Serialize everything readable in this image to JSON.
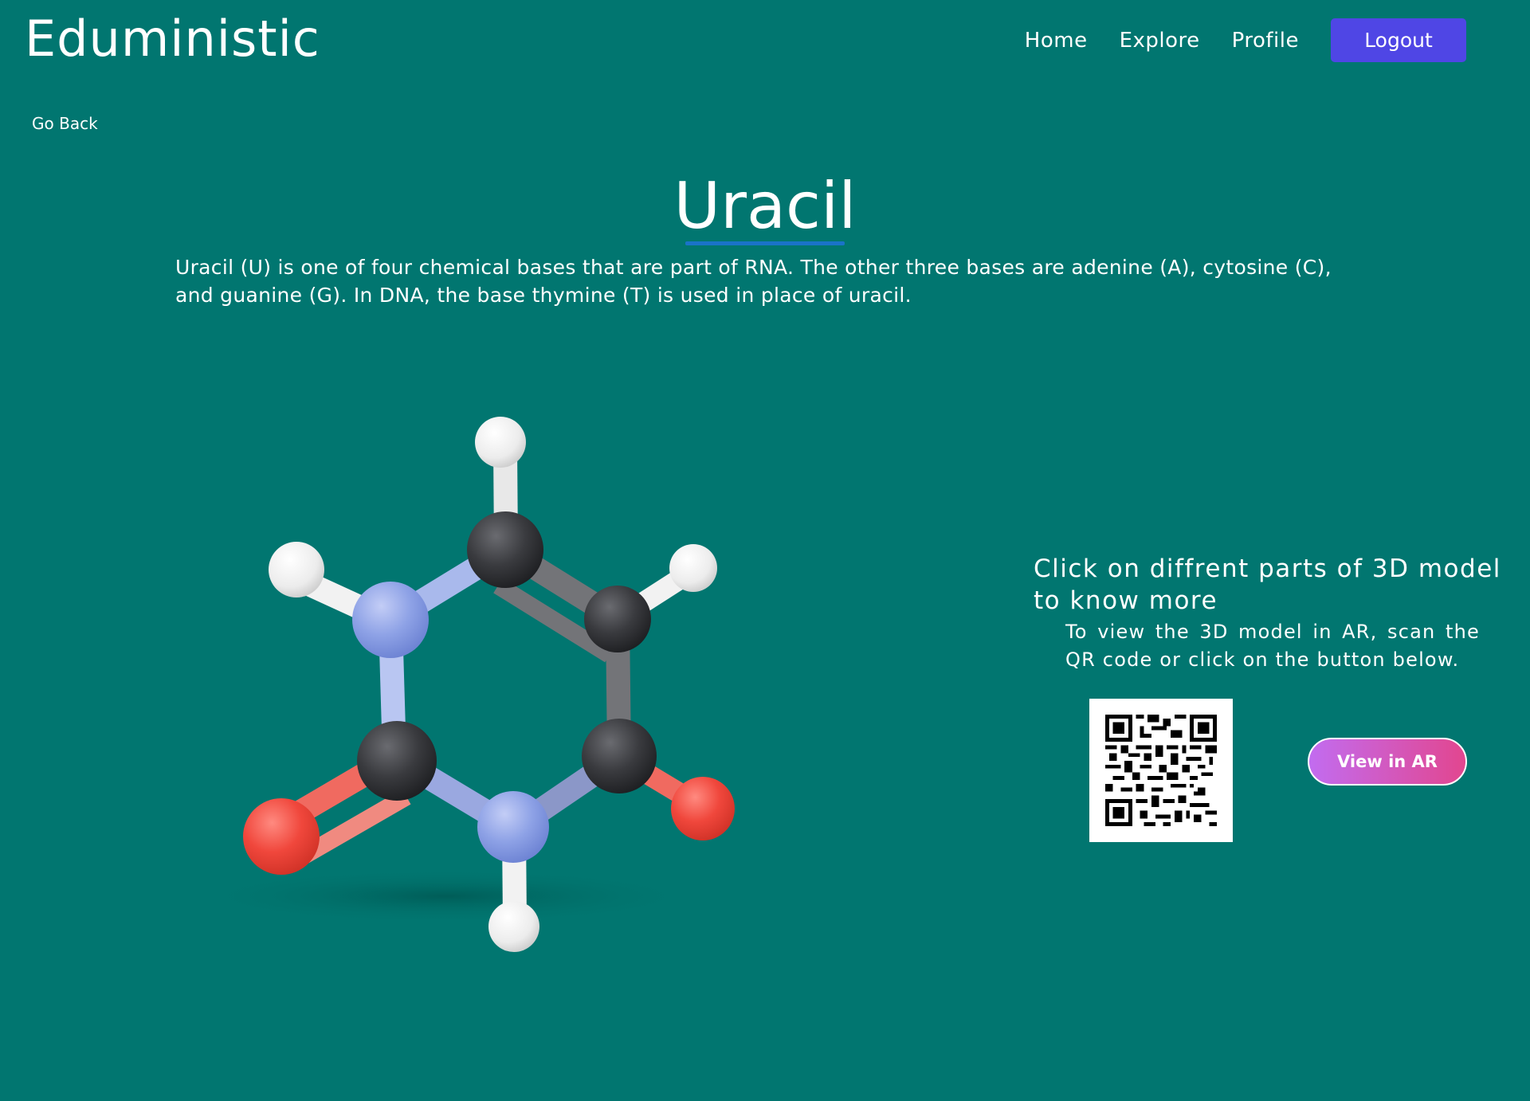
{
  "header": {
    "brand": "Eduministic",
    "nav": {
      "home": "Home",
      "explore": "Explore",
      "profile": "Profile",
      "logout": "Logout"
    }
  },
  "go_back": "Go Back",
  "molecule": {
    "title": "Uracil",
    "description": "Uracil (U) is one of four chemical bases that are part of RNA. The other three bases are adenine (A), cytosine (C), and guanine (G). In DNA, the base thymine (T) is used in place of uracil."
  },
  "side_panel": {
    "heading": "Click on diffrent parts of 3D model to know more",
    "instruction": "To view the 3D model in AR, scan the QR code or click on the button below.",
    "ar_button": "View in AR"
  },
  "colors": {
    "background": "#017670",
    "logout_button": "#4f46e5",
    "title_underline": "#1a73c8",
    "ar_gradient_start": "#c26cf0",
    "ar_gradient_end": "#e2468f"
  }
}
